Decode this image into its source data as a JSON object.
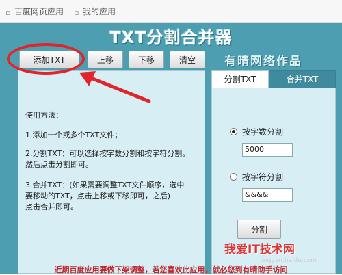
{
  "topbar": {
    "link1": "百度网页应用",
    "link2": "我的应用"
  },
  "app": {
    "title": "TXT分割合并器",
    "author": "有晴网络作品",
    "toolbar": {
      "add": "添加TXT",
      "up": "上移",
      "down": "下移",
      "clear": "清空"
    },
    "instructions": {
      "heading": "使用方法：",
      "step1": "1.添加一个或多个TXT文件；",
      "step2_l1": "2.分割TXT：可以选择按字数分割和按字符分割。",
      "step2_l2": "然后点击分割即可。",
      "step3_l1": "3.合并TXT：(如果需要调整TXT文件顺序，选中",
      "step3_l2": "要移动的TXT，点击上移或下移即可，之后)",
      "step3_l3": "点击合并即可。"
    },
    "tabs": {
      "split": "分割TXT",
      "merge": "合并TXT",
      "active": "split"
    },
    "split_options": {
      "by_count_label": "按字数分割",
      "by_count_value": "5000",
      "by_count_selected": true,
      "by_char_label": "按字符分割",
      "by_char_value": "&&&&",
      "by_char_selected": false,
      "split_button": "分割"
    },
    "bottom_note": "近期百度应用要做下架调整，若您喜欢此应用，就必您到有晴助手访问"
  },
  "watermark": {
    "main": "我爱IT技术网",
    "sub": "jingyan.baidu.com"
  },
  "colors": {
    "app_bg": "#4d9eb1",
    "panel_bg": "#d7eef4",
    "highlight_red": "#e0262a"
  }
}
